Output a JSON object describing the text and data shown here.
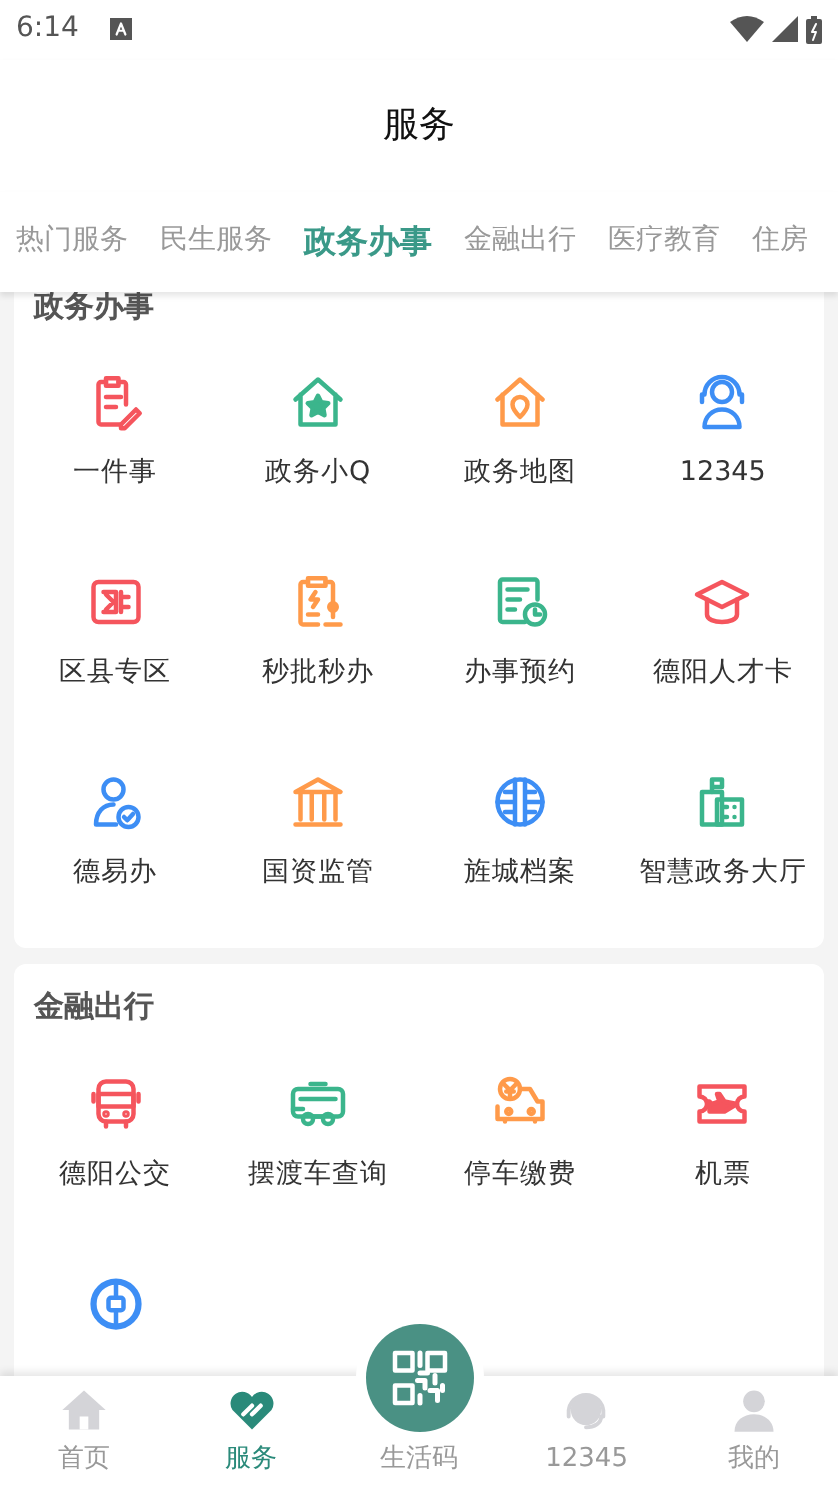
{
  "status_bar": {
    "time": "6:14"
  },
  "header": {
    "title": "服务"
  },
  "tabs": [
    {
      "label": "热门服务",
      "selected": false
    },
    {
      "label": "民生服务",
      "selected": false
    },
    {
      "label": "政务办事",
      "selected": true
    },
    {
      "label": "金融出行",
      "selected": false
    },
    {
      "label": "医疗教育",
      "selected": false
    },
    {
      "label": "住房",
      "selected": false
    }
  ],
  "sections": [
    {
      "title": "政务办事",
      "items": [
        {
          "label": "一件事",
          "color": "#f5555d"
        },
        {
          "label": "政务小Q",
          "color": "#3bb58c"
        },
        {
          "label": "政务地图",
          "color": "#ff9a4a"
        },
        {
          "label": "12345",
          "color": "#3d8ef5"
        },
        {
          "label": "区县专区",
          "color": "#f5555d"
        },
        {
          "label": "秒批秒办",
          "color": "#ff9a4a"
        },
        {
          "label": "办事预约",
          "color": "#3bb58c"
        },
        {
          "label": "德阳人才卡",
          "color": "#f5555d"
        },
        {
          "label": "德易办",
          "color": "#3d8ef5"
        },
        {
          "label": "国资监管",
          "color": "#ff9a4a"
        },
        {
          "label": "旌城档案",
          "color": "#3d8ef5"
        },
        {
          "label": "智慧政务大厅",
          "color": "#3bb58c"
        }
      ]
    },
    {
      "title": "金融出行",
      "items": [
        {
          "label": "德阳公交",
          "color": "#f5555d"
        },
        {
          "label": "摆渡车查询",
          "color": "#3bb58c"
        },
        {
          "label": "停车缴费",
          "color": "#ff9a4a"
        },
        {
          "label": "机票",
          "color": "#f5555d"
        },
        {
          "color": "#3d8ef5"
        }
      ]
    }
  ],
  "bottom_nav": [
    {
      "label": "首页",
      "selected": false
    },
    {
      "label": "服务",
      "selected": true
    },
    {
      "label": "生活码",
      "selected": false
    },
    {
      "label": "12345",
      "selected": false
    },
    {
      "label": "我的",
      "selected": false
    }
  ]
}
